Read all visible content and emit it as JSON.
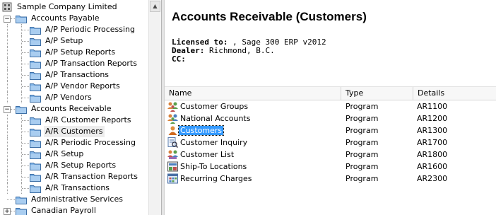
{
  "tree": {
    "root": "Sample Company Limited",
    "items": [
      {
        "label": "Accounts Payable",
        "level": 1,
        "expanded": true
      },
      {
        "label": "A/P Periodic Processing",
        "level": 2
      },
      {
        "label": "A/P Setup",
        "level": 2
      },
      {
        "label": "A/P Setup Reports",
        "level": 2
      },
      {
        "label": "A/P Transaction Reports",
        "level": 2
      },
      {
        "label": "A/P Transactions",
        "level": 2
      },
      {
        "label": "A/P Vendor Reports",
        "level": 2
      },
      {
        "label": "A/P Vendors",
        "level": 2
      },
      {
        "label": "Accounts Receivable",
        "level": 1,
        "expanded": true
      },
      {
        "label": "A/R Customer Reports",
        "level": 2
      },
      {
        "label": "A/R Customers",
        "level": 2,
        "selected": true
      },
      {
        "label": "A/R Periodic Processing",
        "level": 2
      },
      {
        "label": "A/R Setup",
        "level": 2
      },
      {
        "label": "A/R Setup Reports",
        "level": 2
      },
      {
        "label": "A/R Transaction Reports",
        "level": 2
      },
      {
        "label": "A/R Transactions",
        "level": 2
      },
      {
        "label": "Administrative Services",
        "level": 1
      },
      {
        "label": "Canadian Payroll",
        "level": 1,
        "expanded": false
      }
    ]
  },
  "main": {
    "title": "Accounts Receivable (Customers)",
    "licensed_label": "Licensed to:",
    "licensed_value": ", Sage 300 ERP v2012",
    "dealer_label": "Dealer:",
    "dealer_value": "Richmond, B.C.",
    "cc_label": "CC:",
    "columns": [
      "Name",
      "Type",
      "Details"
    ],
    "rows": [
      {
        "name": "Customer Groups",
        "type": "Program",
        "details": "AR1100",
        "icon": "customer-groups-icon"
      },
      {
        "name": "National Accounts",
        "type": "Program",
        "details": "AR1200",
        "icon": "national-accounts-icon"
      },
      {
        "name": "Customers",
        "type": "Program",
        "details": "AR1300",
        "icon": "customers-icon",
        "selected": true
      },
      {
        "name": "Customer Inquiry",
        "type": "Program",
        "details": "AR1700",
        "icon": "customer-inquiry-icon"
      },
      {
        "name": "Customer List",
        "type": "Program",
        "details": "AR1800",
        "icon": "customer-list-icon"
      },
      {
        "name": "Ship-To Locations",
        "type": "Program",
        "details": "AR1600",
        "icon": "ship-to-locations-icon"
      },
      {
        "name": "Recurring Charges",
        "type": "Program",
        "details": "AR2300",
        "icon": "recurring-charges-icon"
      }
    ]
  },
  "colors": {
    "selection": "#3399ff",
    "folder": "#7fb2e5",
    "tree_selected_bg": "#ededed"
  }
}
